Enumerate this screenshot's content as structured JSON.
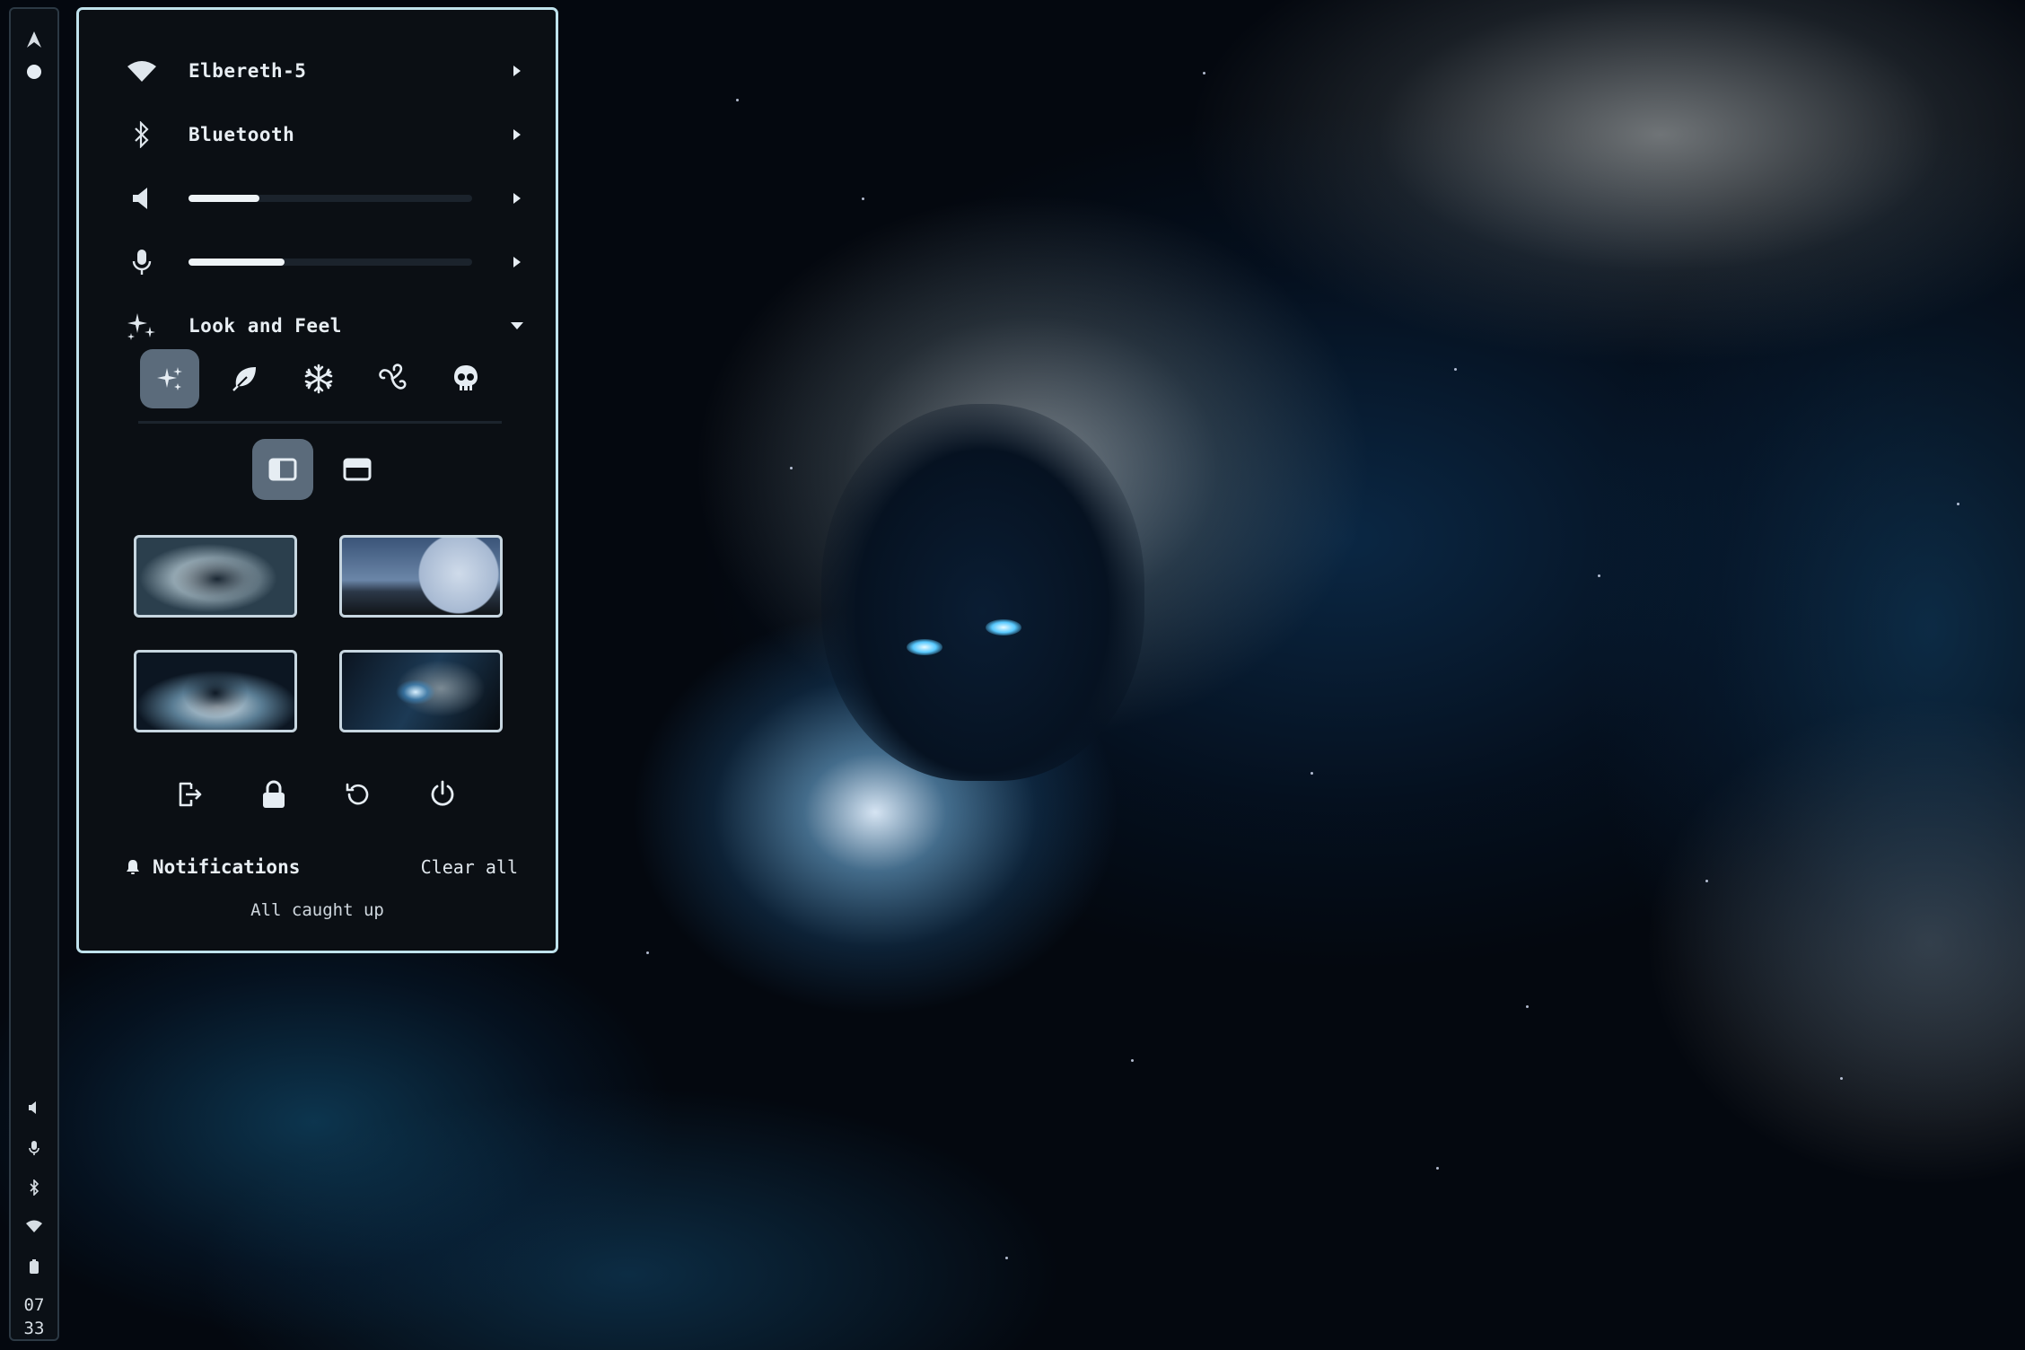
{
  "panel": {
    "wifi": {
      "label": "Elbereth-5",
      "icon": "wifi-icon"
    },
    "bluetooth": {
      "label": "Bluetooth",
      "icon": "bluetooth-icon"
    },
    "volume": {
      "icon": "speaker-icon",
      "level": 0.25
    },
    "microphone": {
      "icon": "microphone-icon",
      "level": 0.34
    },
    "look_and_feel": {
      "label": "Look and Feel",
      "icon": "sparkles-icon",
      "themes": [
        "sparkles-icon",
        "leaf-icon",
        "snowflake-icon",
        "triskelion-icon",
        "skull-icon"
      ],
      "active_theme": 0,
      "layouts": [
        "sidebar-layout-icon",
        "topbar-layout-icon"
      ],
      "active_layout": 0,
      "wallpapers": 4
    },
    "power": [
      "logout-icon",
      "lock-icon",
      "restart-icon",
      "power-icon"
    ],
    "notifications": {
      "title": "Notifications",
      "clear_label": "Clear all",
      "empty_text": "All caught up"
    }
  },
  "bar": {
    "top_icon": "arch-logo-icon",
    "bottom_icons": [
      "speaker-icon",
      "microphone-icon",
      "bluetooth-icon",
      "wifi-icon",
      "battery-icon"
    ],
    "clock_hour": "07",
    "clock_minute": "33"
  },
  "colors": {
    "accent": "#bfe2ec",
    "panel_bg": "#0b0f14",
    "active_bg": "#5b6b7b"
  }
}
